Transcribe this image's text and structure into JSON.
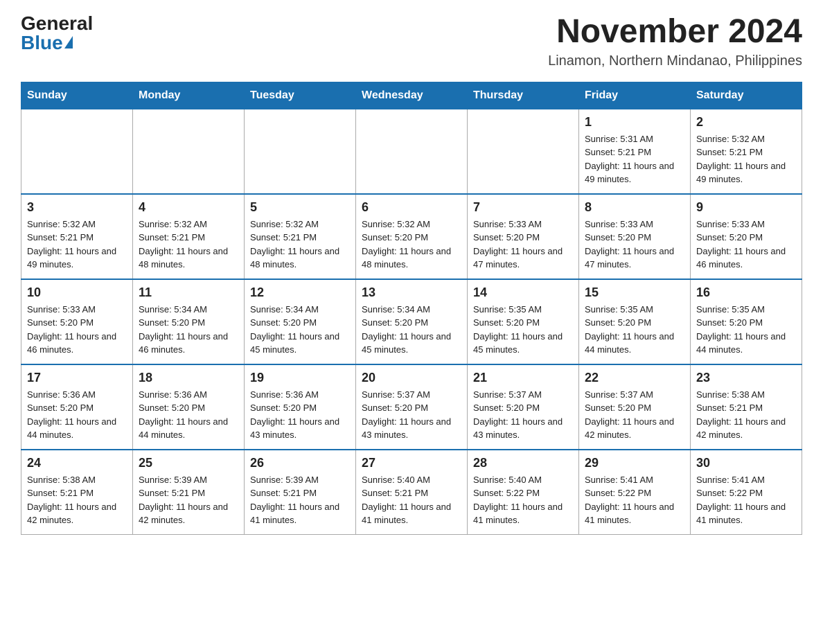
{
  "logo": {
    "general": "General",
    "blue": "Blue"
  },
  "title": "November 2024",
  "subtitle": "Linamon, Northern Mindanao, Philippines",
  "days_of_week": [
    "Sunday",
    "Monday",
    "Tuesday",
    "Wednesday",
    "Thursday",
    "Friday",
    "Saturday"
  ],
  "weeks": [
    [
      {
        "day": "",
        "info": ""
      },
      {
        "day": "",
        "info": ""
      },
      {
        "day": "",
        "info": ""
      },
      {
        "day": "",
        "info": ""
      },
      {
        "day": "",
        "info": ""
      },
      {
        "day": "1",
        "info": "Sunrise: 5:31 AM\nSunset: 5:21 PM\nDaylight: 11 hours and 49 minutes."
      },
      {
        "day": "2",
        "info": "Sunrise: 5:32 AM\nSunset: 5:21 PM\nDaylight: 11 hours and 49 minutes."
      }
    ],
    [
      {
        "day": "3",
        "info": "Sunrise: 5:32 AM\nSunset: 5:21 PM\nDaylight: 11 hours and 49 minutes."
      },
      {
        "day": "4",
        "info": "Sunrise: 5:32 AM\nSunset: 5:21 PM\nDaylight: 11 hours and 48 minutes."
      },
      {
        "day": "5",
        "info": "Sunrise: 5:32 AM\nSunset: 5:21 PM\nDaylight: 11 hours and 48 minutes."
      },
      {
        "day": "6",
        "info": "Sunrise: 5:32 AM\nSunset: 5:20 PM\nDaylight: 11 hours and 48 minutes."
      },
      {
        "day": "7",
        "info": "Sunrise: 5:33 AM\nSunset: 5:20 PM\nDaylight: 11 hours and 47 minutes."
      },
      {
        "day": "8",
        "info": "Sunrise: 5:33 AM\nSunset: 5:20 PM\nDaylight: 11 hours and 47 minutes."
      },
      {
        "day": "9",
        "info": "Sunrise: 5:33 AM\nSunset: 5:20 PM\nDaylight: 11 hours and 46 minutes."
      }
    ],
    [
      {
        "day": "10",
        "info": "Sunrise: 5:33 AM\nSunset: 5:20 PM\nDaylight: 11 hours and 46 minutes."
      },
      {
        "day": "11",
        "info": "Sunrise: 5:34 AM\nSunset: 5:20 PM\nDaylight: 11 hours and 46 minutes."
      },
      {
        "day": "12",
        "info": "Sunrise: 5:34 AM\nSunset: 5:20 PM\nDaylight: 11 hours and 45 minutes."
      },
      {
        "day": "13",
        "info": "Sunrise: 5:34 AM\nSunset: 5:20 PM\nDaylight: 11 hours and 45 minutes."
      },
      {
        "day": "14",
        "info": "Sunrise: 5:35 AM\nSunset: 5:20 PM\nDaylight: 11 hours and 45 minutes."
      },
      {
        "day": "15",
        "info": "Sunrise: 5:35 AM\nSunset: 5:20 PM\nDaylight: 11 hours and 44 minutes."
      },
      {
        "day": "16",
        "info": "Sunrise: 5:35 AM\nSunset: 5:20 PM\nDaylight: 11 hours and 44 minutes."
      }
    ],
    [
      {
        "day": "17",
        "info": "Sunrise: 5:36 AM\nSunset: 5:20 PM\nDaylight: 11 hours and 44 minutes."
      },
      {
        "day": "18",
        "info": "Sunrise: 5:36 AM\nSunset: 5:20 PM\nDaylight: 11 hours and 44 minutes."
      },
      {
        "day": "19",
        "info": "Sunrise: 5:36 AM\nSunset: 5:20 PM\nDaylight: 11 hours and 43 minutes."
      },
      {
        "day": "20",
        "info": "Sunrise: 5:37 AM\nSunset: 5:20 PM\nDaylight: 11 hours and 43 minutes."
      },
      {
        "day": "21",
        "info": "Sunrise: 5:37 AM\nSunset: 5:20 PM\nDaylight: 11 hours and 43 minutes."
      },
      {
        "day": "22",
        "info": "Sunrise: 5:37 AM\nSunset: 5:20 PM\nDaylight: 11 hours and 42 minutes."
      },
      {
        "day": "23",
        "info": "Sunrise: 5:38 AM\nSunset: 5:21 PM\nDaylight: 11 hours and 42 minutes."
      }
    ],
    [
      {
        "day": "24",
        "info": "Sunrise: 5:38 AM\nSunset: 5:21 PM\nDaylight: 11 hours and 42 minutes."
      },
      {
        "day": "25",
        "info": "Sunrise: 5:39 AM\nSunset: 5:21 PM\nDaylight: 11 hours and 42 minutes."
      },
      {
        "day": "26",
        "info": "Sunrise: 5:39 AM\nSunset: 5:21 PM\nDaylight: 11 hours and 41 minutes."
      },
      {
        "day": "27",
        "info": "Sunrise: 5:40 AM\nSunset: 5:21 PM\nDaylight: 11 hours and 41 minutes."
      },
      {
        "day": "28",
        "info": "Sunrise: 5:40 AM\nSunset: 5:22 PM\nDaylight: 11 hours and 41 minutes."
      },
      {
        "day": "29",
        "info": "Sunrise: 5:41 AM\nSunset: 5:22 PM\nDaylight: 11 hours and 41 minutes."
      },
      {
        "day": "30",
        "info": "Sunrise: 5:41 AM\nSunset: 5:22 PM\nDaylight: 11 hours and 41 minutes."
      }
    ]
  ]
}
